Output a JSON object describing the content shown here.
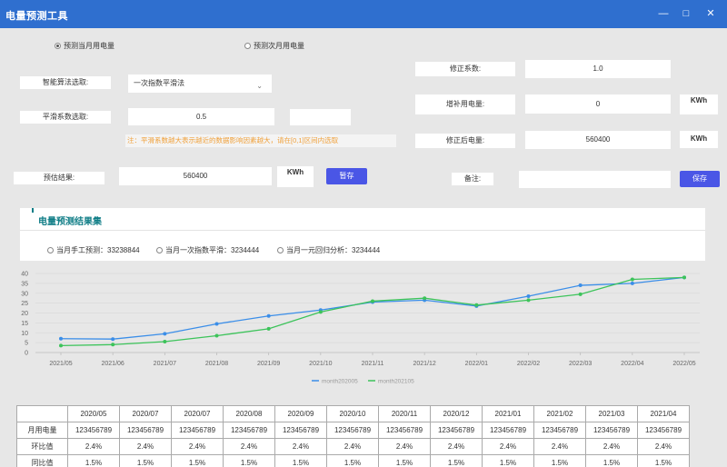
{
  "window": {
    "title": "电量预测工具",
    "min_icon": "minimize-icon",
    "max_icon": "maximize-icon",
    "close_icon": "close-icon"
  },
  "mode": {
    "option_current": "预测当月用电量",
    "option_next": "预测次月用电量",
    "selected": "option_current"
  },
  "algorithm": {
    "label": "智能算法选取:",
    "value": "一次指数平滑法"
  },
  "smoothing": {
    "label": "平滑系数选取:",
    "value": "0.5",
    "hint": "注：平滑系数越大表示越近的数据影响因素越大，请在[0,1]区间内选取"
  },
  "estimate": {
    "label": "预估结果:",
    "value": "560400",
    "unit": "KWh",
    "save_temp_label": "暂存"
  },
  "correction": {
    "coef_label": "修正系数:",
    "coef_value": "1.0",
    "add_label": "增补用电量:",
    "add_value": "0",
    "add_unit": "KWh",
    "corrected_label": "修正后电量:",
    "corrected_value": "560400",
    "corrected_unit": "KWh",
    "note_label": "备注:",
    "note_value": "",
    "save_label": "保存"
  },
  "results": {
    "title": "电量预测结果集",
    "items": [
      "当月手工预测：33238844",
      "当月一次指数平滑：3234444",
      "当月一元回归分析：3234444"
    ]
  },
  "chart_data": {
    "type": "line",
    "categories": [
      "2021/05",
      "2021/06",
      "2021/07",
      "2021/08",
      "2021/09",
      "2021/10",
      "2021/11",
      "2021/12",
      "2022/01",
      "2022/02",
      "2022/03",
      "2022/04",
      "2022/05"
    ],
    "ylim": [
      0,
      40
    ],
    "yticks": [
      "0",
      "5",
      "10",
      "15",
      "20",
      "25",
      "30",
      "35",
      "40"
    ],
    "grid": true,
    "legend_position": "bottom",
    "series": [
      {
        "name": "month202005",
        "color": "#3b8ee8",
        "values": [
          7,
          6.8,
          9.5,
          14.5,
          18.5,
          21.5,
          25.5,
          26.5,
          23.5,
          28.5,
          34,
          35,
          38
        ]
      },
      {
        "name": "month202105",
        "color": "#3cc35a",
        "values": [
          3.5,
          4,
          5.5,
          8.5,
          12,
          20.5,
          26,
          27.5,
          24,
          26.5,
          29.5,
          37,
          38
        ]
      }
    ]
  },
  "table": {
    "headers": [
      "",
      "2020/05",
      "2020/07",
      "2020/07",
      "2020/08",
      "2020/09",
      "2020/10",
      "2020/11",
      "2020/12",
      "2021/01",
      "2021/02",
      "2021/03",
      "2021/04"
    ],
    "rows": [
      [
        "月用电量",
        "123456789",
        "123456789",
        "123456789",
        "123456789",
        "123456789",
        "123456789",
        "123456789",
        "123456789",
        "123456789",
        "123456789",
        "123456789",
        "123456789"
      ],
      [
        "环比值",
        "2.4%",
        "2.4%",
        "2.4%",
        "2.4%",
        "2.4%",
        "2.4%",
        "2.4%",
        "2.4%",
        "2.4%",
        "2.4%",
        "2.4%",
        "2.4%"
      ],
      [
        "同比值",
        "1.5%",
        "1.5%",
        "1.5%",
        "1.5%",
        "1.5%",
        "1.5%",
        "1.5%",
        "1.5%",
        "1.5%",
        "1.5%",
        "1.5%",
        "1.5%"
      ]
    ]
  }
}
